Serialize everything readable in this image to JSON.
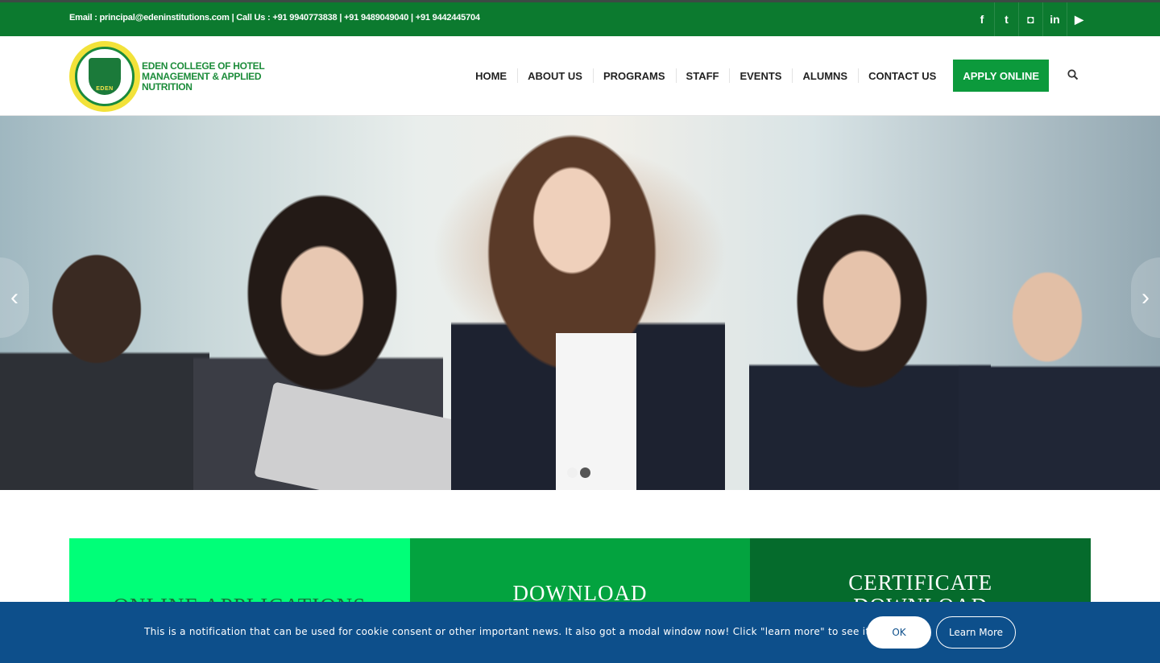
{
  "topbar": {
    "contact_text": "Email : principal@edeninstitutions.com | Call Us : +91 9940773838 | +91 9489049040 | +91 9442445704",
    "social": [
      {
        "icon": "facebook-icon",
        "glyph": "f"
      },
      {
        "icon": "twitter-icon",
        "glyph": "t"
      },
      {
        "icon": "instagram-icon",
        "glyph": "◘"
      },
      {
        "icon": "linkedin-icon",
        "glyph": "in"
      },
      {
        "icon": "youtube-icon",
        "glyph": "▶"
      }
    ]
  },
  "header": {
    "logo_badge": "EDEN",
    "logo_line1": "EDEN COLLEGE OF HOTEL",
    "logo_line2": "MANAGEMENT & APPLIED NUTRITION",
    "nav": [
      "HOME",
      "ABOUT US",
      "PROGRAMS",
      "STAFF",
      "EVENTS",
      "ALUMNS",
      "CONTACT US"
    ],
    "apply_label": "APPLY ONLINE"
  },
  "hero": {
    "prev_glyph": "‹",
    "next_glyph": "›",
    "slide_count": 2,
    "active_slide": 2
  },
  "boxes": [
    {
      "label": "ONLINE APPLICATIONS"
    },
    {
      "label": "DOWNLOAD"
    },
    {
      "label": "CERTIFICATE DOWNLOAD"
    }
  ],
  "cookie": {
    "message": "This is a notification that can be used for cookie consent or other important news. It also got a modal window now! Click \"learn more\" to see it!",
    "ok_label": "OK",
    "learn_label": "Learn More"
  },
  "colors": {
    "brand_green": "#0c7a2f",
    "apply_green": "#0c9a3c",
    "box1": "#00ff78",
    "box2": "#03a33f",
    "box3": "#056b2c",
    "cookie_blue": "#0d4f8b"
  }
}
